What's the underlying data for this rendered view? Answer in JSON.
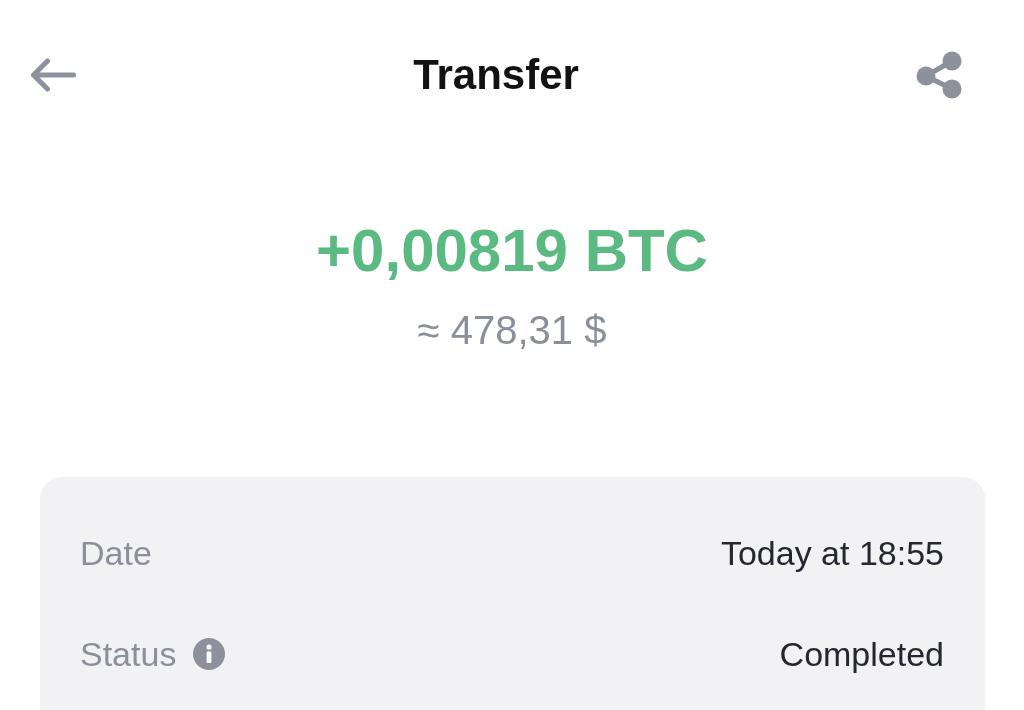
{
  "header": {
    "title": "Transfer"
  },
  "amount": {
    "value": "+0,00819 BTC",
    "fiat": "≈ 478,31 $"
  },
  "details": {
    "rows": [
      {
        "label": "Date",
        "value": "Today at 18:55",
        "has_info": false
      },
      {
        "label": "Status",
        "value": "Completed",
        "has_info": true
      }
    ]
  }
}
